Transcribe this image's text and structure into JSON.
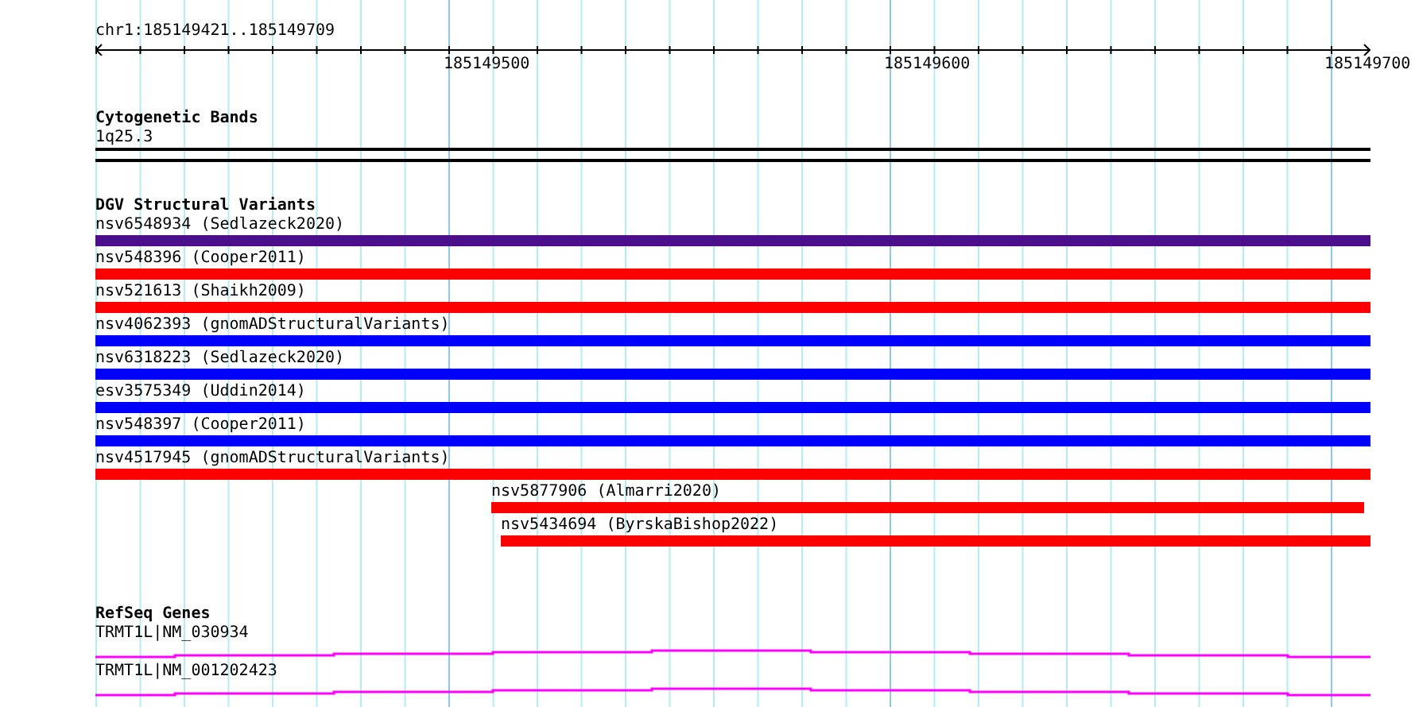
{
  "ruler": {
    "range": "chr1:185149421..185149709",
    "ticks": [
      "185149500",
      "185149600",
      "185149700"
    ]
  },
  "tracks": [
    {
      "kind": "bands",
      "title": "Cytogenetic Bands",
      "items": [
        {
          "label": "1q25.3"
        }
      ]
    },
    {
      "kind": "variants",
      "title": "DGV Structural Variants",
      "items": [
        {
          "label": "nsv6548934 (Sedlazeck2020)",
          "color": "#4b0f8c",
          "kind": "full"
        },
        {
          "label": "nsv548396 (Cooper2011)",
          "color": "#ff0000",
          "kind": "full"
        },
        {
          "label": "nsv521613 (Shaikh2009)",
          "color": "#ff0000",
          "kind": "full"
        },
        {
          "label": "nsv4062393 (gnomADStructuralVariants)",
          "color": "#0000ff",
          "kind": "full"
        },
        {
          "label": "nsv6318223 (Sedlazeck2020)",
          "color": "#0000ff",
          "kind": "full"
        },
        {
          "label": "esv3575349 (Uddin2014)",
          "color": "#0000ff",
          "kind": "full"
        },
        {
          "label": "nsv548397 (Cooper2011)",
          "color": "#0000ff",
          "kind": "full"
        },
        {
          "label": "nsv4517945 (gnomADStructuralVariants)",
          "color": "#ff0000",
          "kind": "full"
        },
        {
          "label": "nsv5877906 (Almarri2020)",
          "color": "#ff0000",
          "kind": "mid"
        },
        {
          "label": "nsv5434694 (ByrskaBishop2022)",
          "color": "#ff0000",
          "kind": "late"
        }
      ]
    },
    {
      "kind": "genes",
      "title": "RefSeq Genes",
      "items": [
        {
          "label": "TRMT1L|NM_030934"
        },
        {
          "label": "TRMT1L|NM_001202423"
        }
      ]
    }
  ]
}
